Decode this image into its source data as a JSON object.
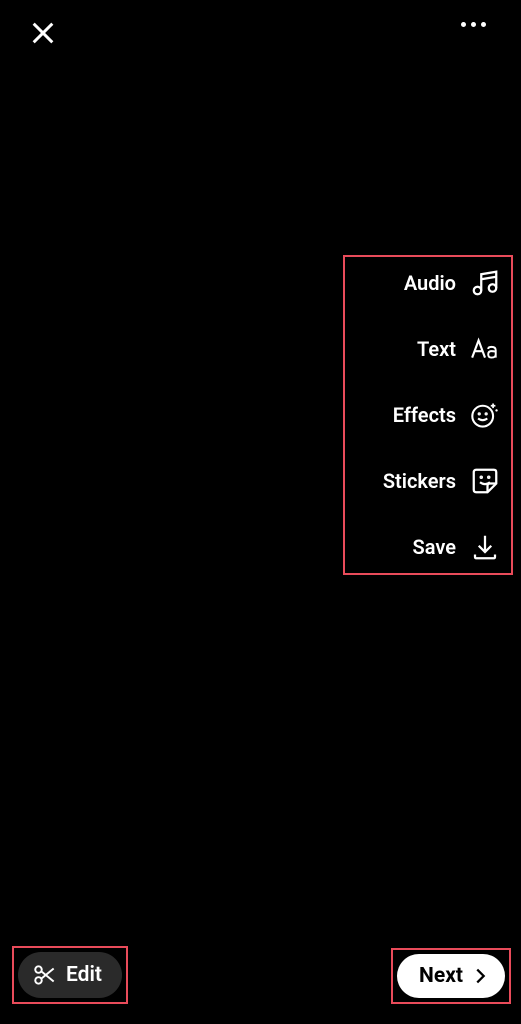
{
  "tools": {
    "audio": "Audio",
    "text": "Text",
    "effects": "Effects",
    "stickers": "Stickers",
    "save": "Save"
  },
  "buttons": {
    "edit": "Edit",
    "next": "Next"
  }
}
